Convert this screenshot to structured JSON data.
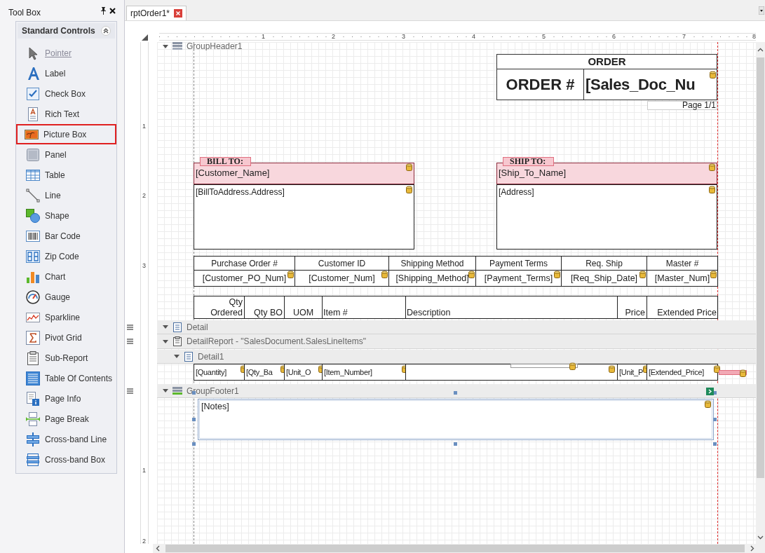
{
  "toolbox": {
    "title": "Tool Box",
    "group": {
      "title": "Standard Controls",
      "expanded": true
    },
    "items": [
      {
        "label": "Pointer",
        "selected": false,
        "disabled": true
      },
      {
        "label": "Label",
        "selected": false,
        "disabled": false
      },
      {
        "label": "Check Box",
        "selected": false,
        "disabled": false
      },
      {
        "label": "Rich Text",
        "selected": false,
        "disabled": false
      },
      {
        "label": "Picture Box",
        "selected": true,
        "disabled": false
      },
      {
        "label": "Panel",
        "selected": false,
        "disabled": false
      },
      {
        "label": "Table",
        "selected": false,
        "disabled": false
      },
      {
        "label": "Line",
        "selected": false,
        "disabled": false
      },
      {
        "label": "Shape",
        "selected": false,
        "disabled": false
      },
      {
        "label": "Bar Code",
        "selected": false,
        "disabled": false
      },
      {
        "label": "Zip Code",
        "selected": false,
        "disabled": false
      },
      {
        "label": "Chart",
        "selected": false,
        "disabled": false
      },
      {
        "label": "Gauge",
        "selected": false,
        "disabled": false
      },
      {
        "label": "Sparkline",
        "selected": false,
        "disabled": false
      },
      {
        "label": "Pivot Grid",
        "selected": false,
        "disabled": false
      },
      {
        "label": "Sub-Report",
        "selected": false,
        "disabled": false
      },
      {
        "label": "Table Of Contents",
        "selected": false,
        "disabled": false
      },
      {
        "label": "Page Info",
        "selected": false,
        "disabled": false
      },
      {
        "label": "Page Break",
        "selected": false,
        "disabled": false
      },
      {
        "label": "Cross-band Line",
        "selected": false,
        "disabled": false
      },
      {
        "label": "Cross-band Box",
        "selected": false,
        "disabled": false
      }
    ]
  },
  "tabs": [
    {
      "label": "rptOrder1*",
      "selected": true
    }
  ],
  "ruler": {
    "h_marks": [
      "1",
      "2",
      "3",
      "4",
      "5",
      "6",
      "7",
      "8"
    ],
    "v_marks": [
      "1",
      "2",
      "3",
      "1",
      "2"
    ]
  },
  "bands": [
    {
      "caption": "GroupHeader1",
      "expanded": true
    },
    {
      "caption": "Detail",
      "expanded": true
    },
    {
      "caption": "DetailReport - \"SalesDocument.SalesLineItems\"",
      "expanded": true
    },
    {
      "caption": "Detail1",
      "expanded": true
    },
    {
      "caption": "GroupFooter1",
      "expanded": true
    }
  ],
  "report": {
    "header": {
      "title": "ORDER",
      "order_label": "ORDER #",
      "order_field": "[Sales_Doc_Nu",
      "page_info": "Page 1/1"
    },
    "addresses": [
      {
        "label": "BILL TO:",
        "name": "[Customer_Name]",
        "address": "[BillToAddress.Address]"
      },
      {
        "label": "SHIP TO:",
        "name": "[Ship_To_Name]",
        "address": "[Address]"
      }
    ],
    "info_table": {
      "columns": [
        "Purchase Order #",
        "Customer ID",
        "Shipping Method",
        "Payment Terms",
        "Req. Ship",
        "Master #"
      ],
      "cells": [
        "[Customer_PO_Num]",
        "[Customer_Num]",
        "[Shipping_Method]",
        "[Payment_Terms]",
        "[Req_Ship_Date]",
        "[Master_Num]"
      ]
    },
    "items_header": [
      "Qty\nOrdered",
      "Qty BO",
      "UOM",
      "Item #",
      "Description",
      "Price",
      "Extended Price"
    ],
    "detail_cells": [
      {
        "kind": "field",
        "text": "[Quantity]"
      },
      {
        "kind": "field",
        "text": "[Qty_Ba"
      },
      {
        "kind": "field",
        "text": "[Unit_O"
      },
      {
        "kind": "field",
        "text": "[Item_Number]"
      },
      {
        "kind": "blank"
      },
      {
        "kind": "field",
        "text": "[Unit_P"
      },
      {
        "kind": "field",
        "text": "[Extended_Price]"
      }
    ],
    "notes": {
      "text": "[Notes]",
      "selected": true
    }
  }
}
